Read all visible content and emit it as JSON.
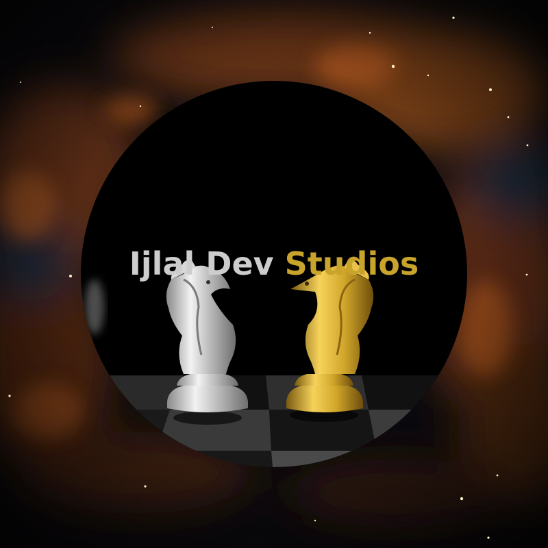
{
  "logo": {
    "text_part1": "Ijlal Dev",
    "text_part2": "Studios",
    "color_part1": "#cdcdcd",
    "color_part2": "#c9a42c"
  },
  "pieces": [
    {
      "name": "silver-knight",
      "color": "#c8c8c8"
    },
    {
      "name": "gold-knight",
      "color": "#d1a82a"
    }
  ],
  "background": {
    "theme": "nebula",
    "colors": [
      "#0b0b10",
      "#7a3c14",
      "#1b2230"
    ]
  }
}
